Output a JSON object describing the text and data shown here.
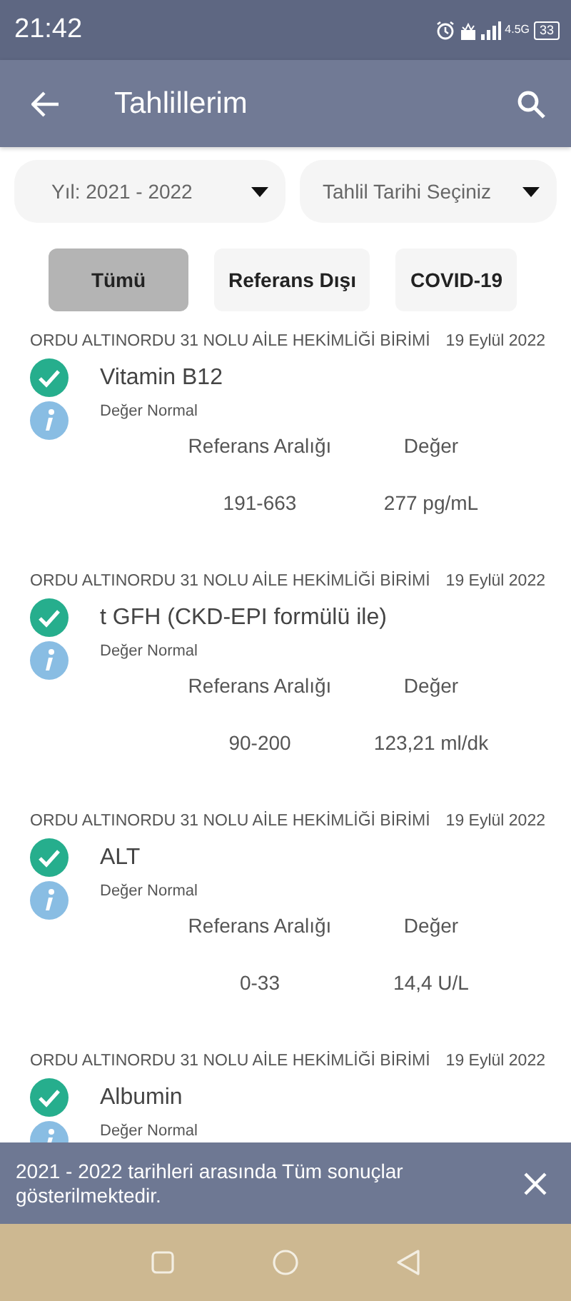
{
  "status_bar": {
    "time": "21:42",
    "network": "4.5G",
    "battery": "33"
  },
  "app_bar": {
    "title": "Tahlillerim"
  },
  "filters": [
    {
      "label": "Yıl: 2021 - 2022"
    },
    {
      "label": "Tahlil Tarihi Seçiniz"
    }
  ],
  "chips": [
    {
      "label": "Tümü",
      "selected": true
    },
    {
      "label": "Referans Dışı",
      "selected": false
    },
    {
      "label": "COVID-19",
      "selected": false
    }
  ],
  "results": [
    {
      "institution": "ORDU ALTINORDU 31 NOLU AİLE HEKİMLİĞİ BİRİMİ",
      "date": "19 Eylül 2022",
      "test": "Vitamin B12",
      "note": "Değer Normal",
      "range_label": "Referans Aralığı",
      "value_label": "Değer",
      "range": "191-663",
      "value": "277 pg/mL"
    },
    {
      "institution": "ORDU ALTINORDU 31 NOLU AİLE HEKİMLİĞİ BİRİMİ",
      "date": "19 Eylül 2022",
      "test": "t GFH (CKD-EPI formülü ile)",
      "note": "Değer Normal",
      "range_label": "Referans Aralığı",
      "value_label": "Değer",
      "range": "90-200",
      "value": "123,21 ml/dk"
    },
    {
      "institution": "ORDU ALTINORDU 31 NOLU AİLE HEKİMLİĞİ BİRİMİ",
      "date": "19 Eylül 2022",
      "test": "ALT",
      "note": "Değer Normal",
      "range_label": "Referans Aralığı",
      "value_label": "Değer",
      "range": "0-33",
      "value": "14,4 U/L"
    },
    {
      "institution": "ORDU ALTINORDU 31 NOLU AİLE HEKİMLİĞİ BİRİMİ",
      "date": "19 Eylül 2022",
      "test": "Albumin",
      "note": "Değer Normal"
    }
  ],
  "banner": {
    "message": "2021 - 2022 tarihleri arasında Tüm sonuçlar gösterilmektedir."
  }
}
